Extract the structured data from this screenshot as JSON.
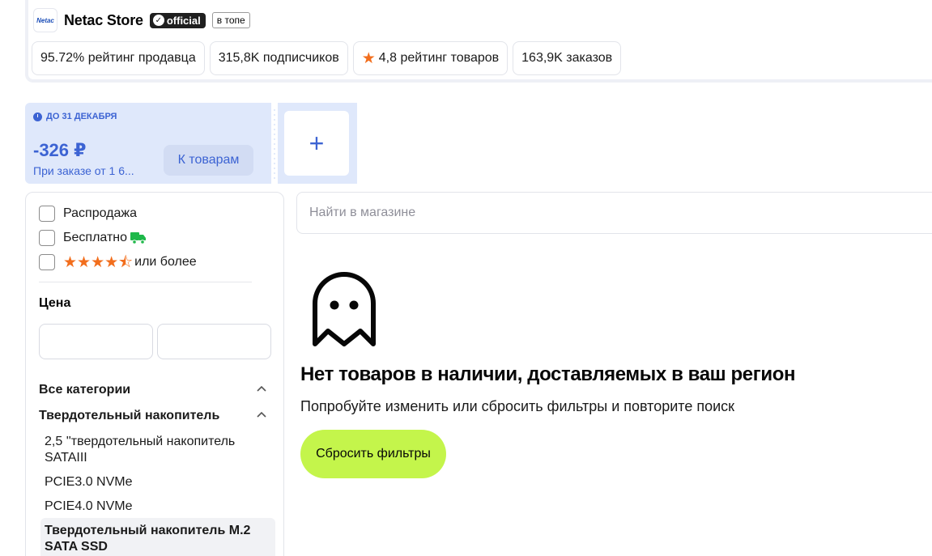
{
  "store": {
    "logo_text": "Netac",
    "name": "Netac Store",
    "official_badge": "official",
    "top_badge": "в топе",
    "stats": [
      {
        "text": "95.72% рейтинг продавца"
      },
      {
        "text": "315,8K подписчиков"
      },
      {
        "text": "4,8 рейтинг товаров",
        "icon": "star-icon"
      },
      {
        "text": "163,9K заказов"
      }
    ]
  },
  "coupon": {
    "date": "ДО 31 ДЕКАБРЯ",
    "amount": "-326 ₽",
    "condition": "При заказе от 1 6...",
    "button": "К товарам",
    "add_symbol": "+"
  },
  "filters": {
    "sale": "Распродажа",
    "free_delivery": "Бесплатно",
    "rating_suffix": "или более",
    "rating_stars": "★★★★⯪",
    "price_label": "Цена",
    "all_categories": "Все категории",
    "ssd_category": "Твердотельный накопитель",
    "subcategories": [
      "2,5 ''твердотельный накопитель SATAIII",
      "PCIE3.0 NVMe",
      "PCIE4.0 NVMe",
      "Твердотельный накопитель M.2 SATA SSD"
    ]
  },
  "search": {
    "placeholder": "Найти в магазине"
  },
  "empty": {
    "title": "Нет товаров в наличии, доставляемых в ваш регион",
    "subtitle": "Попробуйте изменить или сбросить фильтры и повторите поиск",
    "reset_button": "Сбросить фильтры"
  },
  "colors": {
    "accent": "#3c63d3",
    "star": "#f26e1d",
    "reset": "#c4f54b",
    "delivery": "#1fb84a"
  }
}
